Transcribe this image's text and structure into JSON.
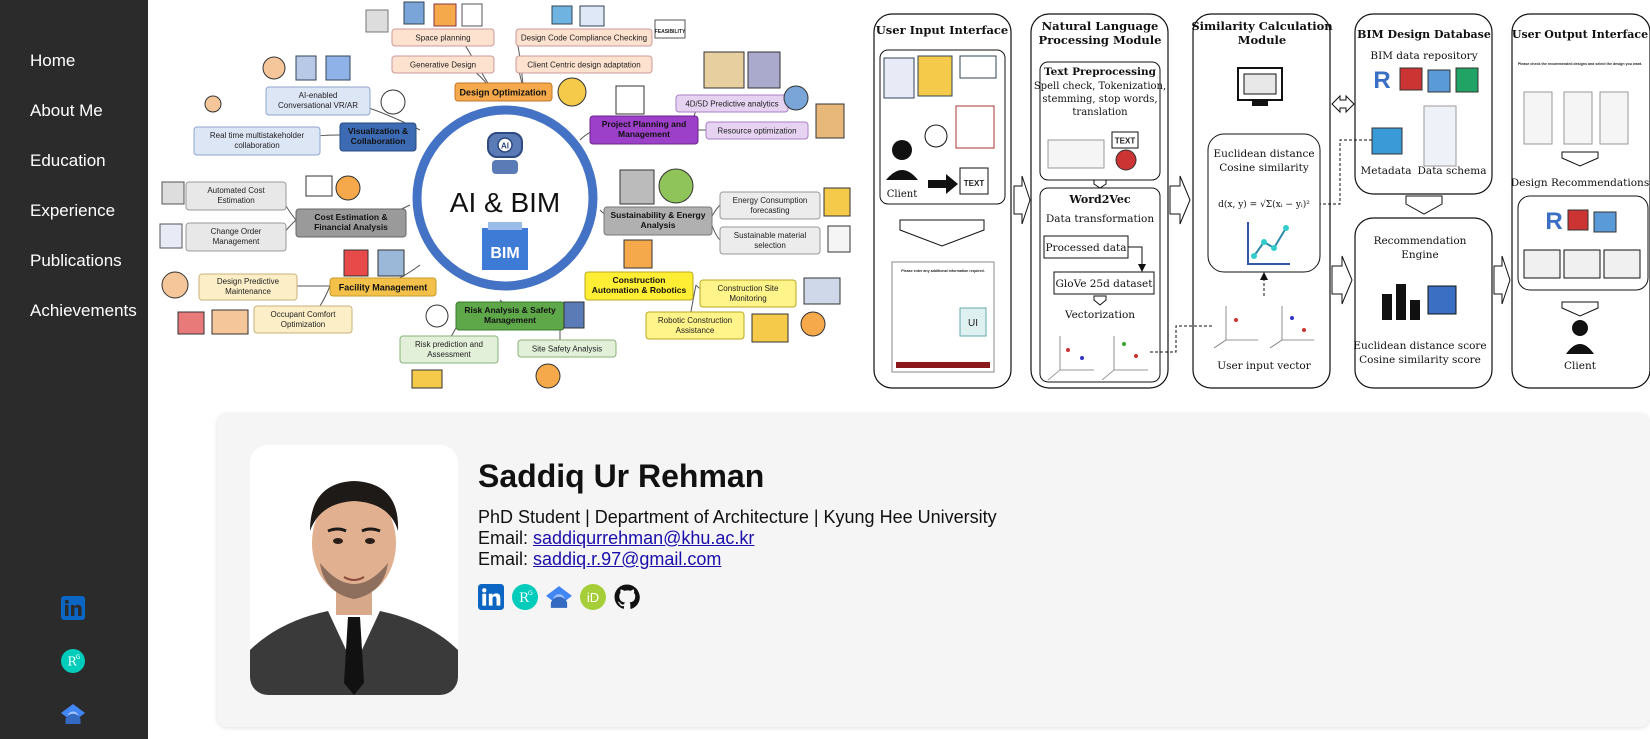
{
  "sidebar": {
    "nav": [
      {
        "label": "Home"
      },
      {
        "label": "About Me"
      },
      {
        "label": "Education"
      },
      {
        "label": "Experience"
      },
      {
        "label": "Publications"
      },
      {
        "label": "Achievements"
      }
    ],
    "icons": [
      "linkedin-icon",
      "researchgate-icon",
      "google-scholar-icon"
    ]
  },
  "banner": {
    "mindmap": {
      "center_title": "AI & BIM",
      "center_badge": "BIM",
      "ai_badge": "AI",
      "categories": [
        "Design Optimization",
        "Visualization & Collaboration",
        "Cost Estimation & Financial Analysis",
        "Facility Management",
        "Risk Analysis & Safety Management",
        "Construction Automation & Robotics",
        "Sustainability & Energy Analysis",
        "Project Planning and Management"
      ],
      "items": [
        "Space planning",
        "Generative Design",
        "Design Code Compliance Checking",
        "Client Centric design adaptation",
        "AI-enabled Conversational VR/AR",
        "Real time multistakeholder collaboration",
        "Automated Cost Estimation",
        "Change Order Management",
        "Design Predictive Maintenance",
        "Occupant Comfort Optimization",
        "Risk prediction and Assessment",
        "Site Safety Analysis",
        "Construction Site Monitoring",
        "Robotic Construction Assistance",
        "Energy Consumption forecasting",
        "Sustainable material selection",
        "4D/5D Predictive analytics",
        "Resource optimization"
      ],
      "feasibility_label": "FEASIBILITY"
    },
    "flow": {
      "col1_title": "User Input Interface",
      "client_label": "Client",
      "text_badge": "TEXT",
      "ui_badge": "UI",
      "form_caption": "Please enter any additional information required.",
      "col2_title": "Natural Language Processing Module",
      "text_pre_title": "Text Preprocessing",
      "text_pre_desc": [
        "Spell check, Tokenization,",
        "stemming, stop words,",
        "translation"
      ],
      "word2vec_title": "Word2Vec",
      "word2vec_desc": "Data transformation",
      "processed_data": "Processed data",
      "glove": "GloVe 25d dataset",
      "vectorization": "Vectorization",
      "col3_title": "Similarity Calculation Module",
      "similarity_desc": [
        "Euclidean distance",
        "Cosine similarity"
      ],
      "formula": "d(x, y) = √Σ(xᵢ − yᵢ)²",
      "user_input_vector": "User input vector",
      "col4_title": "BIM Design Database",
      "bim_repo": "BIM data repository",
      "metadata": "Metadata",
      "data_schema": "Data schema",
      "rec_engine": [
        "Recommendation",
        "Engine"
      ],
      "scores": [
        "Euclidean distance score",
        "Cosine similarity score"
      ],
      "col5_title": "User Output Interface",
      "output_caption": "Please check the recommended designs and select the design you want.",
      "design_recs": "Design Recommendations",
      "client_label2": "Client"
    }
  },
  "profile": {
    "name": "Saddiq Ur Rehman",
    "subtitle": "PhD Student | Department of Architecture | Kyung Hee University",
    "email_label": "Email:",
    "email1": "saddiqurrehman@khu.ac.kr",
    "email2": "saddiq.r.97@gmail.com",
    "socials": [
      "linkedin-icon",
      "researchgate-icon",
      "google-scholar-icon",
      "orcid-icon",
      "github-icon"
    ]
  },
  "colors": {
    "sidebar_bg": "#2b2b2b",
    "link": "#1a0dab",
    "linkedin": "#0a66c2",
    "researchgate": "#00ccbb",
    "orcid": "#a6ce39",
    "scholar": "#4285f4",
    "card_bg": "#f5f5f5",
    "ring_blue": "#4472c4"
  }
}
